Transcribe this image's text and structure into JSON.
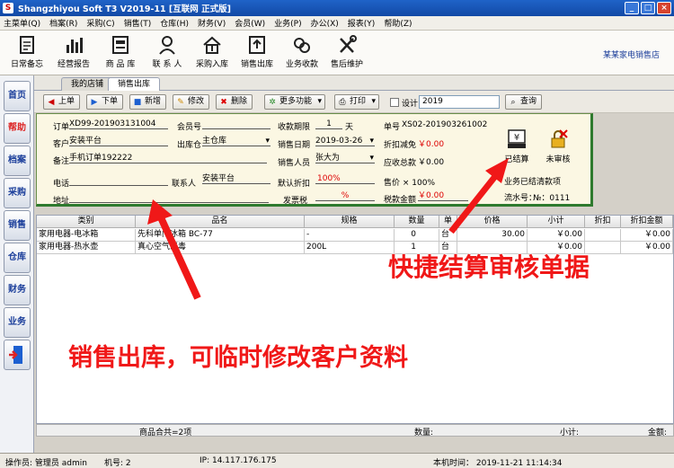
{
  "window": {
    "title": "Shangzhiyou Soft T3 V2019-11 [互联网 正式版]",
    "app_icon": "S"
  },
  "menu": [
    "主菜单(Q)",
    "档案(R)",
    "采购(C)",
    "销售(T)",
    "仓库(H)",
    "财务(V)",
    "会员(W)",
    "业务(P)",
    "办公(X)",
    "报表(Y)",
    "帮助(Z)"
  ],
  "toolbar": [
    {
      "label": "日常备忘",
      "icon": "memo-icon"
    },
    {
      "label": "经营报告",
      "icon": "bar-chart-icon"
    },
    {
      "label": "商 品 库",
      "icon": "product-icon"
    },
    {
      "label": "联 系 人",
      "icon": "contacts-icon"
    },
    {
      "label": "采购入库",
      "icon": "house-in-icon"
    },
    {
      "label": "销售出库",
      "icon": "upload-icon"
    },
    {
      "label": "业务收款",
      "icon": "coins-icon"
    },
    {
      "label": "售后维护",
      "icon": "tools-icon"
    }
  ],
  "company_name": "某某家电销售店",
  "sidebar": [
    "首页",
    "帮助",
    "档案",
    "采购",
    "销售",
    "仓库",
    "财务",
    "业务"
  ],
  "tabs": [
    "我的店铺",
    "销售出库"
  ],
  "actions": {
    "prev": "上单",
    "next": "下单",
    "new": "新增",
    "edit": "修改",
    "delete": "删除",
    "more": "更多功能",
    "print": "打印",
    "design": "设计",
    "year": "2019",
    "query": "查询"
  },
  "form": {
    "order_label": "订单",
    "order_value": "XD99-201903131004",
    "customer_label": "客户",
    "customer_value": "安装平台",
    "remark_label": "备注",
    "remark_value": "手机订单192222",
    "phone_label": "电话",
    "phone_value": "",
    "address_label": "地址",
    "address_value": "",
    "member_label": "会员号",
    "member_value": "",
    "warehouse_label": "出库仓",
    "warehouse_value": "主仓库",
    "contact_label": "联系人",
    "contact_value": "安装平台",
    "due_label": "收款期限",
    "due_value": "1",
    "due_unit": "天",
    "date_label": "销售日期",
    "date_value": "2019-03-26",
    "seller_label": "销售人员",
    "seller_value": "张大为",
    "discount_label": "默认折扣",
    "discount_value": "100%",
    "tax_label": "发票税",
    "tax_value": "%",
    "doc_label": "单号",
    "doc_value": "XS02-201903261002",
    "disc_reduce_label": "折扣减免",
    "disc_reduce_value": "￥0.00",
    "receivable_label": "应收总款",
    "receivable_value": "￥0.00",
    "price_label": "售价 × 100%",
    "tax_amount_label": "税款金额",
    "tax_amount_value": "￥0.00",
    "settled_label": "已结算",
    "unaudit_label": "未审核",
    "status_text": "业务已结清款项",
    "serial_label": "流水号：",
    "serial_value": "№：0111"
  },
  "grid": {
    "headers": [
      "类别",
      "品名",
      "规格",
      "数量",
      "单",
      "价格",
      "小计",
      "折扣",
      "折扣金额"
    ],
    "rows": [
      [
        "家用电器-电冰箱",
        "先科单门冰箱 BC-77",
        "-",
        "0",
        "台",
        "30.00",
        "￥0.00",
        "",
        "￥0.00"
      ],
      [
        "家用电器-热水壶",
        "真心空气消毒",
        "200L",
        "1",
        "台",
        "",
        "￥0.00",
        "",
        "￥0.00"
      ]
    ],
    "total_label": "商品合共=2项",
    "total_qty_label": "数量:",
    "total_sub_label": "小计:",
    "total_amt_label": "金额:"
  },
  "status": {
    "operator": "操作员: 管理员 admin",
    "machine": "机号: 2",
    "ip": "IP: 14.117.176.175",
    "time": "本机时间：  2019-11-21 11:14:34"
  },
  "annotations": {
    "settle": "快捷结算审核单据",
    "edit_customer": "销售出库，可临时修改客户资料"
  },
  "colors": {
    "annotation": "#f01818",
    "title_bar": "#1f63c8",
    "form_bg": "#fbf7e3",
    "money_red": "#d00000"
  }
}
